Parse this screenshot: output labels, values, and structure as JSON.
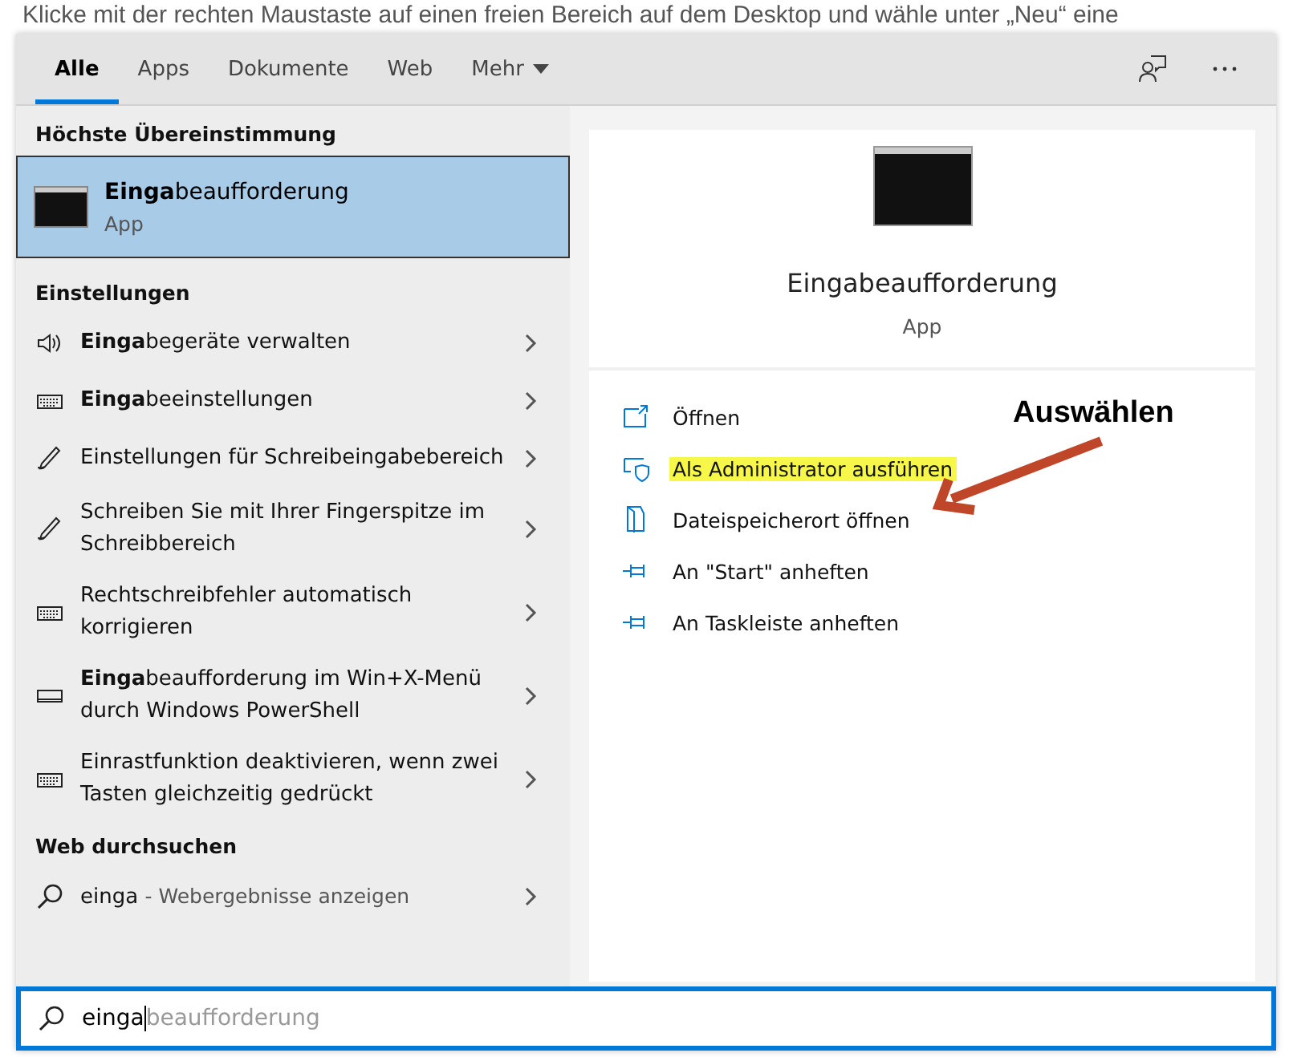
{
  "background": {
    "top_line": "Klicke mit der rechten Maustaste auf einen freien Bereich auf dem Desktop und wähle unter „Neu“ eine"
  },
  "tabs": [
    {
      "label": "Alle",
      "selected": true,
      "kind": "tab"
    },
    {
      "label": "Apps",
      "selected": false,
      "kind": "tab"
    },
    {
      "label": "Dokumente",
      "selected": false,
      "kind": "tab"
    },
    {
      "label": "Web",
      "selected": false,
      "kind": "tab"
    },
    {
      "label": "Mehr",
      "selected": false,
      "kind": "dropdown"
    }
  ],
  "best_match": {
    "heading": "Höchste Übereinstimmung",
    "title": "**Einga**beaufforderung",
    "subtitle": "App",
    "selected": true
  },
  "settings": {
    "heading": "Einstellungen",
    "items": [
      {
        "kind": "speaker",
        "label": "**Einga**begeräte verwalten"
      },
      {
        "kind": "keyboard",
        "label": "**Einga**beeinstellungen"
      },
      {
        "kind": "pen",
        "label": "Einstellungen für Schreibeingabebereich"
      },
      {
        "kind": "pen",
        "label": "Schreiben Sie mit Ihrer Fingerspitze im Schreibbereich"
      },
      {
        "kind": "keyboard",
        "label": "Rechtschreibfehler automatisch korrigieren"
      },
      {
        "kind": "screen",
        "label": "**Einga**beaufforderung im Win+X-Menü durch Windows PowerShell"
      },
      {
        "kind": "keyboard",
        "label": "Einrastfunktion deaktivieren, wenn zwei Tasten gleichzeitig gedrückt"
      }
    ]
  },
  "web": {
    "heading": "Web durchsuchen",
    "query": "einga",
    "hint": "- Webergebnisse anzeigen"
  },
  "preview": {
    "title": "Eingabeaufforderung",
    "subtitle": "App",
    "actions": [
      {
        "kind": "open",
        "label": "Öffnen",
        "highlighted": false
      },
      {
        "kind": "admin",
        "label": "Als Administrator ausführen",
        "highlighted": true
      },
      {
        "kind": "folder",
        "label": "Dateispeicherort öffnen",
        "highlighted": false
      },
      {
        "kind": "pin",
        "label": "An \"Start\" anheften",
        "highlighted": false
      },
      {
        "kind": "pin",
        "label": "An Taskleiste anheften",
        "highlighted": false
      }
    ]
  },
  "annotation": {
    "label": "Auswählen"
  },
  "search": {
    "value": "einga",
    "completion": "beaufforderung"
  }
}
